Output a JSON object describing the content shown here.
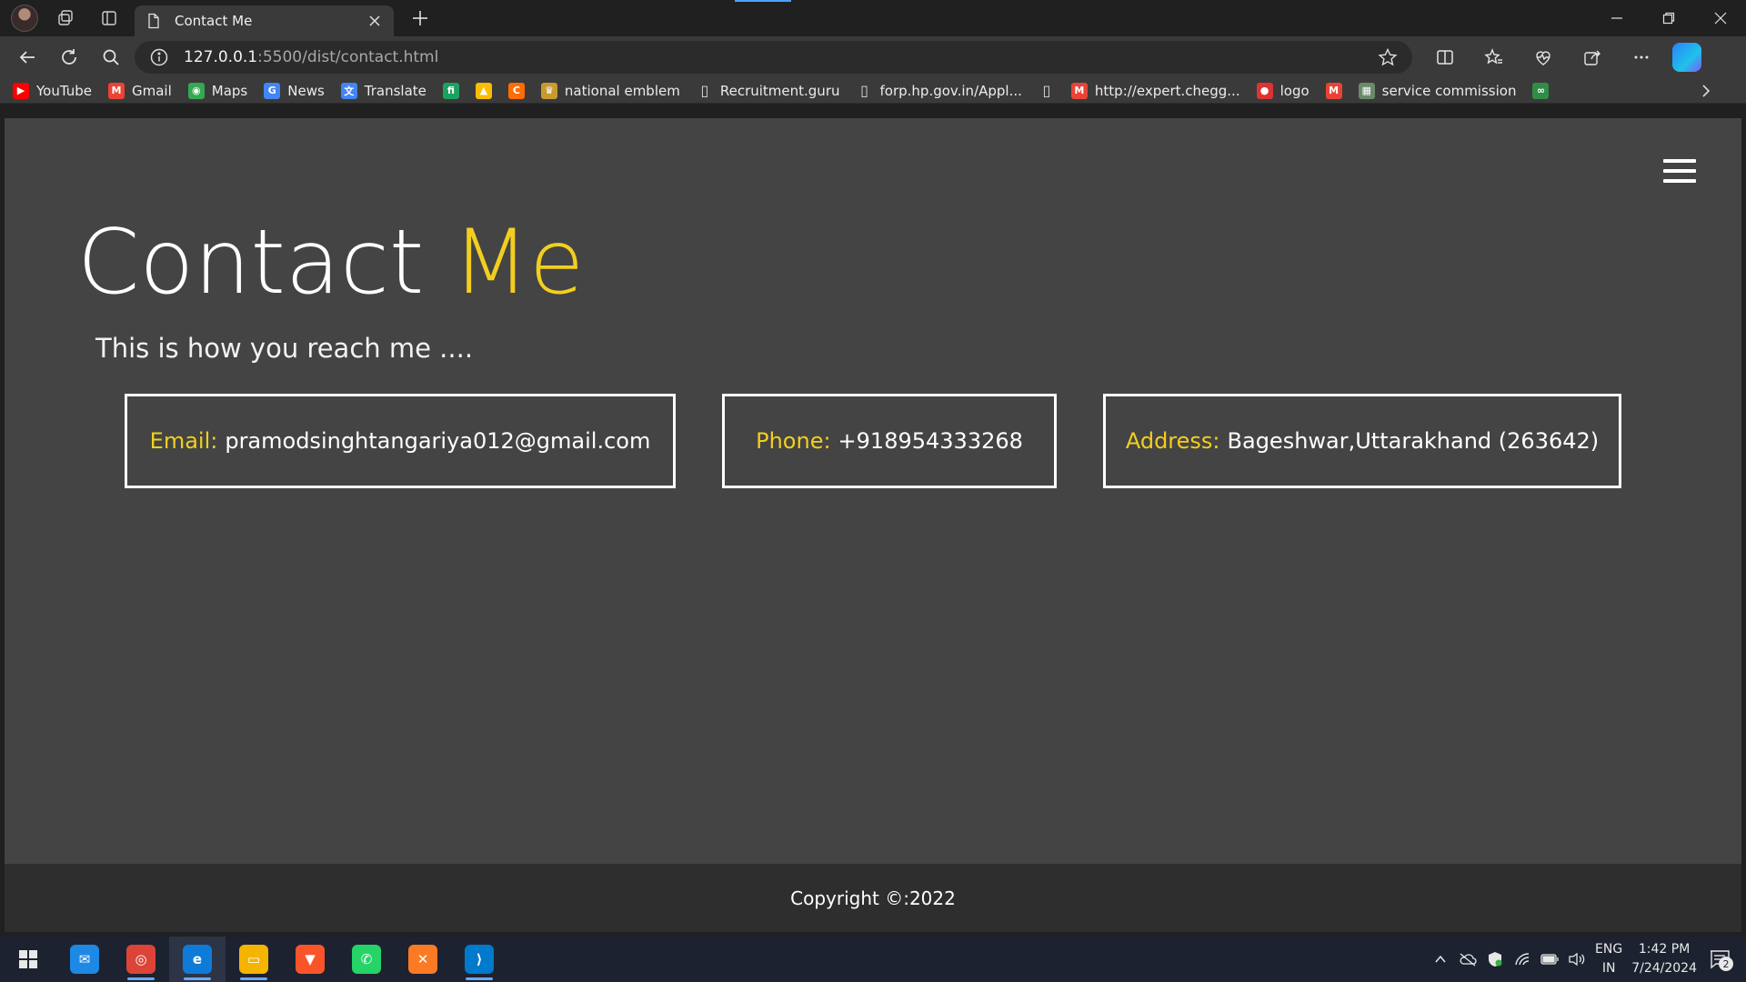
{
  "browser": {
    "tab_title": "Contact Me",
    "url_host": "127.0.0.1",
    "url_path": ":5500/dist/contact.html"
  },
  "bookmarks": [
    {
      "label": "YouTube",
      "icon": "youtube-icon",
      "color": "#ff0000",
      "glyph": "▶"
    },
    {
      "label": "Gmail",
      "icon": "gmail-icon",
      "color": "#ea4335",
      "glyph": "M"
    },
    {
      "label": "Maps",
      "icon": "maps-icon",
      "color": "#34a853",
      "glyph": "◉"
    },
    {
      "label": "News",
      "icon": "news-icon",
      "color": "#4285f4",
      "glyph": "G"
    },
    {
      "label": "Translate",
      "icon": "translate-icon",
      "color": "#4285f4",
      "glyph": "文"
    },
    {
      "label": "",
      "icon": "app-green-icon",
      "color": "#1aa260",
      "glyph": "fi"
    },
    {
      "label": "",
      "icon": "ads-icon",
      "color": "#fbbc04",
      "glyph": "▲"
    },
    {
      "label": "",
      "icon": "app-orange-icon",
      "color": "#ff6d00",
      "glyph": "C"
    },
    {
      "label": "national emblem",
      "icon": "emblem-icon",
      "color": "#c99a2e",
      "glyph": "♛"
    },
    {
      "label": "Recruitment.guru",
      "icon": "page-icon",
      "color": "transparent",
      "glyph": "▯"
    },
    {
      "label": "forp.hp.gov.in/Appl...",
      "icon": "page-icon",
      "color": "transparent",
      "glyph": "▯"
    },
    {
      "label": "",
      "icon": "page-icon",
      "color": "transparent",
      "glyph": "▯"
    },
    {
      "label": "http://expert.chegg...",
      "icon": "gmail-icon",
      "color": "#ea4335",
      "glyph": "M"
    },
    {
      "label": "logo",
      "icon": "logo-icon",
      "color": "#d33",
      "glyph": "●"
    },
    {
      "label": "",
      "icon": "gmail-icon",
      "color": "#ea4335",
      "glyph": "M"
    },
    {
      "label": "service commission",
      "icon": "commission-icon",
      "color": "#6a8a6a",
      "glyph": "▦"
    },
    {
      "label": "",
      "icon": "gfg-icon",
      "color": "#2f8d46",
      "glyph": "∞"
    }
  ],
  "page": {
    "title_main": "Contact ",
    "title_accent": "Me",
    "subtitle": "This is how you reach me ....",
    "contacts": {
      "email_label": "Email:",
      "email_value": "pramodsinghtangariya012@gmail.com",
      "phone_label": "Phone:",
      "phone_value": "+918954333268",
      "address_label": "Address:",
      "address_value": "Bageshwar,Uttarakhand (263642)"
    },
    "footer": "Copyright ©:2022",
    "accent_color": "#f2cf1f"
  },
  "taskbar": {
    "apps": [
      {
        "name": "mail-app",
        "glyph": "✉",
        "color": "#1e88e5"
      },
      {
        "name": "chrome-app",
        "glyph": "◎",
        "color": "#db4437"
      },
      {
        "name": "edge-app",
        "glyph": "e",
        "color": "#0f7bd8"
      },
      {
        "name": "file-explorer-app",
        "glyph": "▭",
        "color": "#f4b400"
      },
      {
        "name": "brave-app",
        "glyph": "▼",
        "color": "#fb542b"
      },
      {
        "name": "whatsapp-app",
        "glyph": "✆",
        "color": "#25d366"
      },
      {
        "name": "xampp-app",
        "glyph": "✕",
        "color": "#fb7a24"
      },
      {
        "name": "vscode-app",
        "glyph": "⟩",
        "color": "#007acc"
      }
    ],
    "lang_top": "ENG",
    "lang_bottom": "IN",
    "time": "1:42 PM",
    "date": "7/24/2024",
    "notification_count": "2"
  }
}
